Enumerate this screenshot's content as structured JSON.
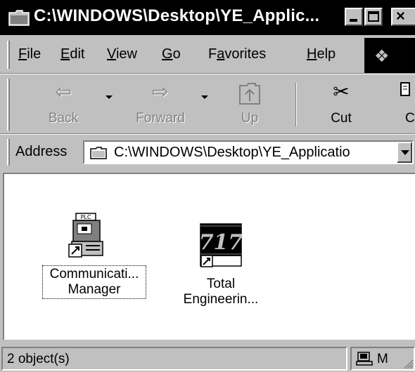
{
  "window": {
    "title": "C:\\WINDOWS\\Desktop\\YE_Applic...",
    "minimize_icon": "minimize-icon",
    "maximize_icon": "maximize-icon",
    "close_icon": "close-icon"
  },
  "menubar": {
    "items": [
      {
        "label": "File",
        "accel": "F"
      },
      {
        "label": "Edit",
        "accel": "E"
      },
      {
        "label": "View",
        "accel": "V"
      },
      {
        "label": "Go",
        "accel": "G"
      },
      {
        "label": "Favorites",
        "accel": "a"
      },
      {
        "label": "Help",
        "accel": "H"
      }
    ]
  },
  "toolbar": {
    "back_label": "Back",
    "forward_label": "Forward",
    "up_label": "Up",
    "cut_label": "Cut",
    "copy_label": "C"
  },
  "address": {
    "label": "Address",
    "value": "C:\\WINDOWS\\Desktop\\YE_Applicatio"
  },
  "files": [
    {
      "line1": "Communicati...",
      "line2": "Manager",
      "icon": "plc-shortcut-icon"
    },
    {
      "line1": "Total",
      "line2": "Engineerin...",
      "icon": "717-shortcut-icon"
    }
  ],
  "icon_badge_text": "717",
  "plc_badge_text": "PLC",
  "status": {
    "objects": "2 object(s)",
    "zone": "M"
  },
  "colors": {
    "titlebar": "#000000",
    "face": "#c0c0c0",
    "content": "#ffffff"
  }
}
